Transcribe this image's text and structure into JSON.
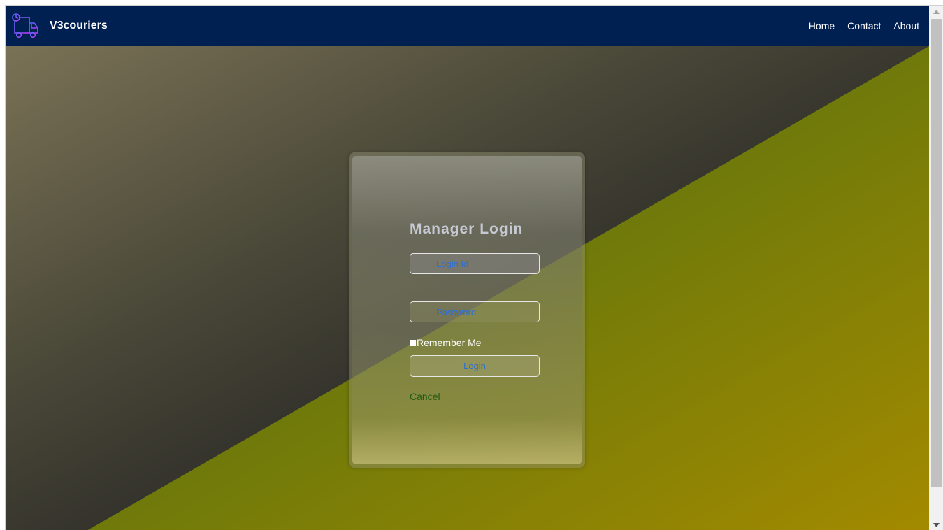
{
  "navbar": {
    "brand_name": "V3couriers",
    "brand_icon": "delivery-truck-icon",
    "links": [
      "Home",
      "Contact",
      "About"
    ],
    "background": "#002052"
  },
  "login_card": {
    "title": "Manager Login",
    "login_id_placeholder": "Login Id",
    "password_placeholder": "Password",
    "remember_label": "Remember Me",
    "login_button": "Login",
    "cancel_link": "Cancel"
  },
  "colors": {
    "accent_text": "#2b6fd8",
    "cancel_link": "#1f5a14",
    "hero_dark": "#2a2a2a",
    "hero_olive": "#7a7a10"
  }
}
